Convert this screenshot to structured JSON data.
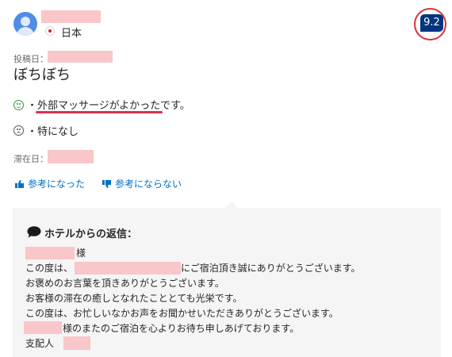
{
  "reviewer": {
    "country": "日本"
  },
  "score": "9.2",
  "posted_label": "投稿日：",
  "review_title": "ぼちぼち",
  "positive": {
    "prefix": "・",
    "highlight": "外部マッサージがよかった",
    "suffix": "です。"
  },
  "negative": {
    "prefix": "・",
    "text": "特になし"
  },
  "stay_label": "滞在日：",
  "helpful_yes": "参考になった",
  "helpful_no": "参考にならない",
  "reply": {
    "heading": "ホテルからの返信：",
    "salutation_suffix": "様",
    "line1_prefix": "この度は、",
    "line1_suffix": "にご宿泊頂き誠にありがとうございます。",
    "line2": "お褒めのお言葉を頂きありがとうございます。",
    "line3": "お客様の滞在の癒しとなれたこととても光栄です。",
    "line4": "この度は、お忙しいなかお声をお聞かせいただきありがとうございます。",
    "line5_suffix": "様のまたのご宿泊を心よりお待ち申しあげております。",
    "signature": "支配人"
  },
  "colors": {
    "score_bg": "#003580",
    "link": "#0071c2",
    "highlight_underline": "#d8304f",
    "redaction": "#f9c6c9"
  },
  "icons": [
    "user-avatar-icon",
    "japan-flag-icon",
    "smile-icon",
    "frown-icon",
    "thumbs-up-icon",
    "thumbs-down-icon",
    "speech-bubble-icon"
  ]
}
